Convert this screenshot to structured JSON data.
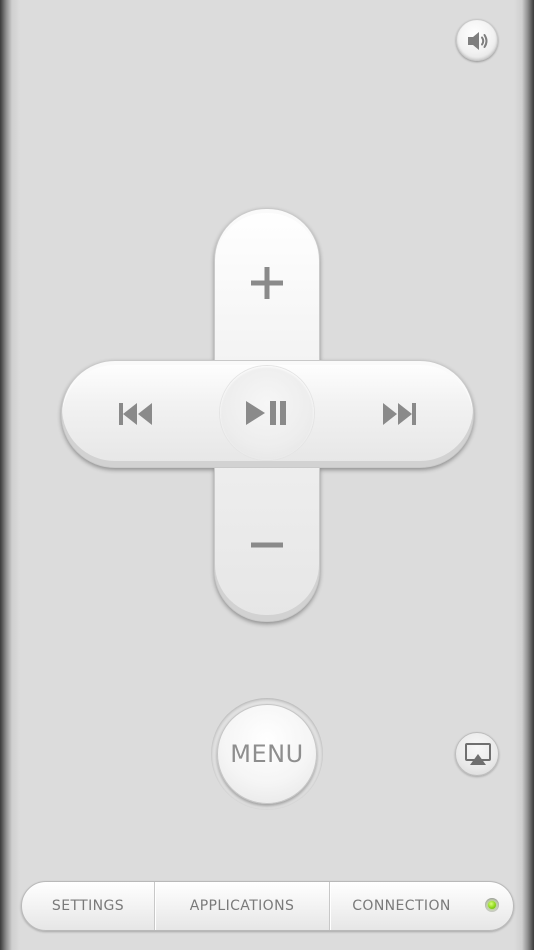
{
  "icons": {
    "volume": "speaker-icon",
    "volume_up": "plus-icon",
    "volume_down": "minus-icon",
    "previous": "skip-back-icon",
    "next": "skip-forward-icon",
    "play_pause": "play-pause-icon",
    "airplay": "airplay-icon",
    "connection_status": "status-led-icon"
  },
  "menu": {
    "label": "MENU"
  },
  "tabs": [
    {
      "label": "SETTINGS"
    },
    {
      "label": "APPLICATIONS"
    },
    {
      "label": "CONNECTION"
    }
  ],
  "colors": {
    "background": "#dcdcdc",
    "icon": "#8f8f8f",
    "status_led": "#8fd81c",
    "text": "#7a7a7a"
  }
}
